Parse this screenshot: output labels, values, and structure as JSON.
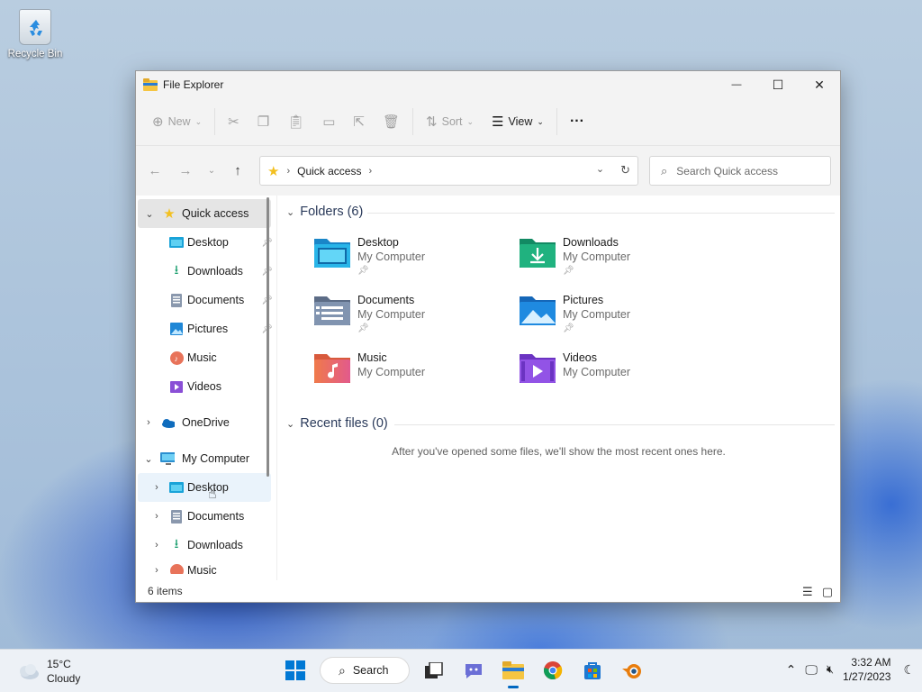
{
  "desktop": {
    "recycle_bin_label": "Recycle Bin"
  },
  "window": {
    "title": "File Explorer",
    "controls": {
      "minimize": "—",
      "maximize": "☐",
      "close": "✕"
    }
  },
  "toolbar": {
    "new_label": "New",
    "sort_label": "Sort",
    "view_label": "View",
    "more_label": "···"
  },
  "address": {
    "location": "Quick access",
    "search_placeholder": "Search Quick access"
  },
  "nav": {
    "quick_access": "Quick access",
    "pinned": [
      {
        "label": "Desktop"
      },
      {
        "label": "Downloads"
      },
      {
        "label": "Documents"
      },
      {
        "label": "Pictures"
      }
    ],
    "music": "Music",
    "videos": "Videos",
    "onedrive": "OneDrive",
    "my_computer": "My Computer",
    "computer_children": [
      {
        "label": "Desktop"
      },
      {
        "label": "Documents"
      },
      {
        "label": "Downloads"
      },
      {
        "label": "Music"
      }
    ]
  },
  "main": {
    "folders_header": "Folders (6)",
    "folders": [
      {
        "name": "Desktop",
        "location": "My Computer",
        "icon": "desktop-folder-icon",
        "pinned": true
      },
      {
        "name": "Downloads",
        "location": "My Computer",
        "icon": "downloads-folder-icon",
        "pinned": true
      },
      {
        "name": "Documents",
        "location": "My Computer",
        "icon": "documents-folder-icon",
        "pinned": true
      },
      {
        "name": "Pictures",
        "location": "My Computer",
        "icon": "pictures-folder-icon",
        "pinned": true
      },
      {
        "name": "Music",
        "location": "My Computer",
        "icon": "music-folder-icon",
        "pinned": false
      },
      {
        "name": "Videos",
        "location": "My Computer",
        "icon": "videos-folder-icon",
        "pinned": false
      }
    ],
    "recent_header": "Recent files (0)",
    "recent_empty": "After you've opened some files, we'll show the most recent ones here."
  },
  "status": {
    "items": "6 items"
  },
  "taskbar": {
    "weather_temp": "15°C",
    "weather_desc": "Cloudy",
    "search_label": "Search",
    "time": "3:32 AM",
    "date": "1/27/2023"
  },
  "colors": {
    "accent": "#0067c0",
    "folder_yellow": "#f5c542"
  }
}
